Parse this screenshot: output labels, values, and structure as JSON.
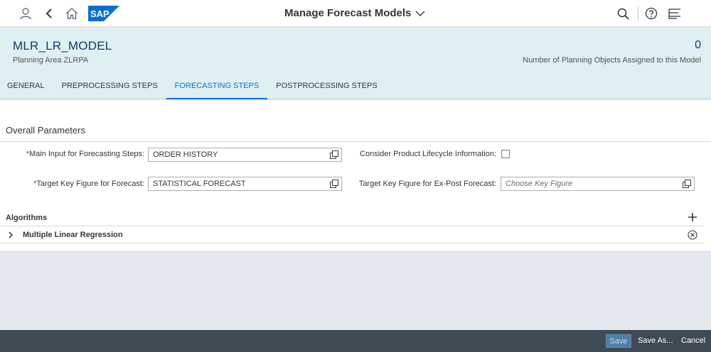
{
  "shell": {
    "title": "Manage Forecast Models",
    "logo_text": "SAP",
    "icons": [
      "user-icon",
      "back-icon",
      "home-icon",
      "search-icon",
      "help-icon",
      "notifications-icon"
    ],
    "brand_color": "#0a6ed1"
  },
  "header": {
    "object_name": "MLR_LR_MODEL",
    "subtitle": "Planning Area ZLRPA",
    "kpi_value": "0",
    "kpi_label": "Number of Planning Objects Assigned to this Model"
  },
  "tabs": [
    {
      "label": "General",
      "active": false
    },
    {
      "label": "Preprocessing Steps",
      "active": false
    },
    {
      "label": "Forecasting Steps",
      "active": true
    },
    {
      "label": "Postprocessing Steps",
      "active": false
    }
  ],
  "overall": {
    "title": "Overall Parameters",
    "main_input": {
      "label": "Main Input for Forecasting Steps:",
      "required_mark": "*",
      "value": "ORDER HISTORY"
    },
    "lifecycle": {
      "label": "Consider Product Lifecycle Information:",
      "checked": false
    },
    "target_kf": {
      "label": "Target Key Figure for Forecast:",
      "required_mark": "*",
      "value": "STATISTICAL FORECAST"
    },
    "expost_kf": {
      "label": "Target Key Figure for Ex-Post Forecast:",
      "value": "",
      "placeholder": "Choose Key Figure"
    }
  },
  "algorithms": {
    "title": "Algorithms",
    "items": [
      {
        "name": "Multiple Linear Regression"
      }
    ]
  },
  "footer": {
    "save_label": "Save",
    "save_as_label": "Save As...",
    "cancel_label": "Cancel"
  }
}
